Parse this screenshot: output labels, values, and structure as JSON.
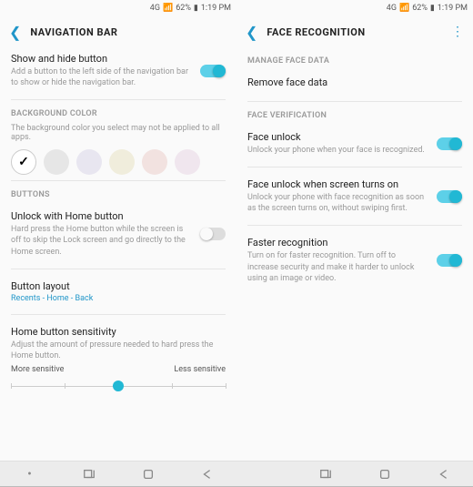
{
  "status": {
    "signal": "4G",
    "battery": "62%",
    "time": "1:19 PM"
  },
  "left": {
    "title": "NAVIGATION BAR",
    "showHide": {
      "title": "Show and hide button",
      "desc": "Add a button to the left side of the navigation bar to show or hide the navigation bar."
    },
    "bgColor": {
      "header": "BACKGROUND COLOR",
      "info": "The background color you select may not be applied to all apps."
    },
    "buttons": {
      "header": "BUTTONS"
    },
    "unlockHome": {
      "title": "Unlock with Home button",
      "desc": "Hard press the Home button while the screen is off to skip the Lock screen and go directly to the Home screen."
    },
    "layout": {
      "title": "Button layout",
      "value": "Recents - Home - Back"
    },
    "sensitivity": {
      "title": "Home button sensitivity",
      "desc": "Adjust the amount of pressure needed to hard press the Home button.",
      "more": "More sensitive",
      "less": "Less sensitive"
    }
  },
  "right": {
    "title": "FACE RECOGNITION",
    "manageHeader": "MANAGE FACE DATA",
    "removeFace": "Remove face data",
    "verifyHeader": "FACE VERIFICATION",
    "faceUnlock": {
      "title": "Face unlock",
      "desc": "Unlock your phone when your face is recognized."
    },
    "screenOn": {
      "title": "Face unlock when screen turns on",
      "desc": "Unlock your phone with face recognition as soon as the screen turns on, without swiping first."
    },
    "faster": {
      "title": "Faster recognition",
      "desc": "Turn on for faster recognition. Turn off to increase security and make it harder to unlock using an image or video."
    }
  }
}
